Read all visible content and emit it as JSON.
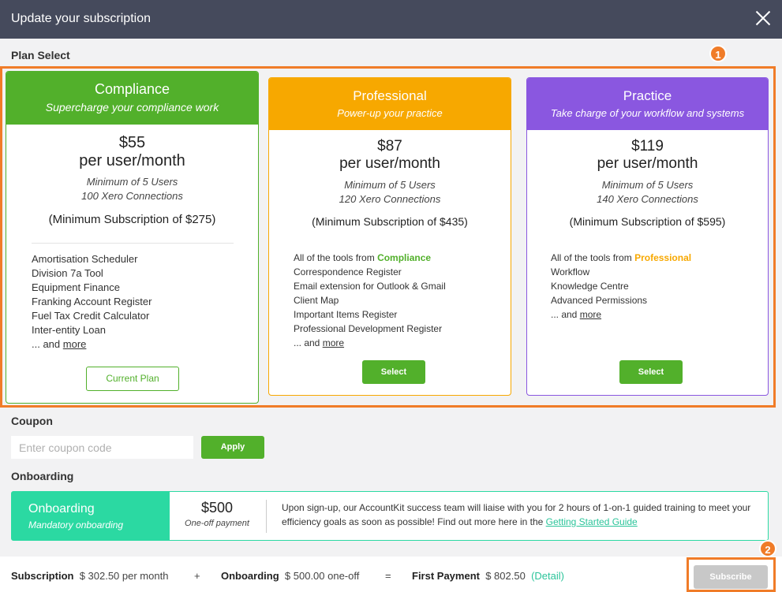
{
  "header": {
    "title": "Update your subscription"
  },
  "sections": {
    "plan_select": "Plan Select",
    "coupon": "Coupon",
    "onboarding": "Onboarding"
  },
  "badges": {
    "one": "1",
    "two": "2"
  },
  "plans": [
    {
      "name": "Compliance",
      "tagline": "Supercharge your compliance work",
      "price": "$55",
      "per": "per user/month",
      "min_users": "Minimum of 5 Users",
      "connections": "100 Xero Connections",
      "min_sub": "(Minimum Subscription of $275)",
      "features": [
        "Amortisation Scheduler",
        "Division 7a Tool",
        "Equipment Finance",
        "Franking Account Register",
        "Fuel Tax Credit Calculator",
        "Inter-entity Loan"
      ],
      "and_text": "... and",
      "more": "more",
      "button": "Current Plan",
      "color": "#52b02b"
    },
    {
      "name": "Professional",
      "tagline": "Power-up your practice",
      "price": "$87",
      "per": "per user/month",
      "min_users": "Minimum of 5 Users",
      "connections": "120 Xero Connections",
      "min_sub": "(Minimum Subscription of $435)",
      "tools_prefix": "All of the tools from",
      "tools_from": "Compliance",
      "features": [
        "Correspondence Register",
        "Email extension for Outlook & Gmail",
        "Client Map",
        "Important Items Register",
        "Professional Development Register"
      ],
      "and_text": "... and",
      "more": "more",
      "button": "Select",
      "color": "#f7a800"
    },
    {
      "name": "Practice",
      "tagline": "Take charge of your workflow and systems",
      "price": "$119",
      "per": "per user/month",
      "min_users": "Minimum of 5 Users",
      "connections": "140 Xero Connections",
      "min_sub": "(Minimum Subscription of $595)",
      "tools_prefix": "All of the tools from",
      "tools_from": "Professional",
      "features": [
        "Workflow",
        "Knowledge Centre",
        "Advanced Permissions"
      ],
      "and_text": "... and",
      "more": "more",
      "button": "Select",
      "color": "#8a57e0"
    }
  ],
  "coupon": {
    "placeholder": "Enter coupon code",
    "apply": "Apply"
  },
  "onboarding": {
    "name": "Onboarding",
    "sub": "Mandatory onboarding",
    "price": "$500",
    "price_note": "One-off payment",
    "desc": "Upon sign-up, our AccountKit success team will liaise with you for 2 hours of 1-on-1 guided training to meet your efficiency goals as soon as possible! Find out more here in the",
    "link": "Getting Started Guide"
  },
  "footer": {
    "subscription_label": "Subscription",
    "subscription_value": "$ 302.50 per month",
    "plus": "+",
    "onboarding_label": "Onboarding",
    "onboarding_value": "$ 500.00 one-off",
    "equals": "=",
    "first_label": "First Payment",
    "first_value": "$ 802.50",
    "detail": "(Detail)",
    "subscribe": "Subscribe"
  }
}
